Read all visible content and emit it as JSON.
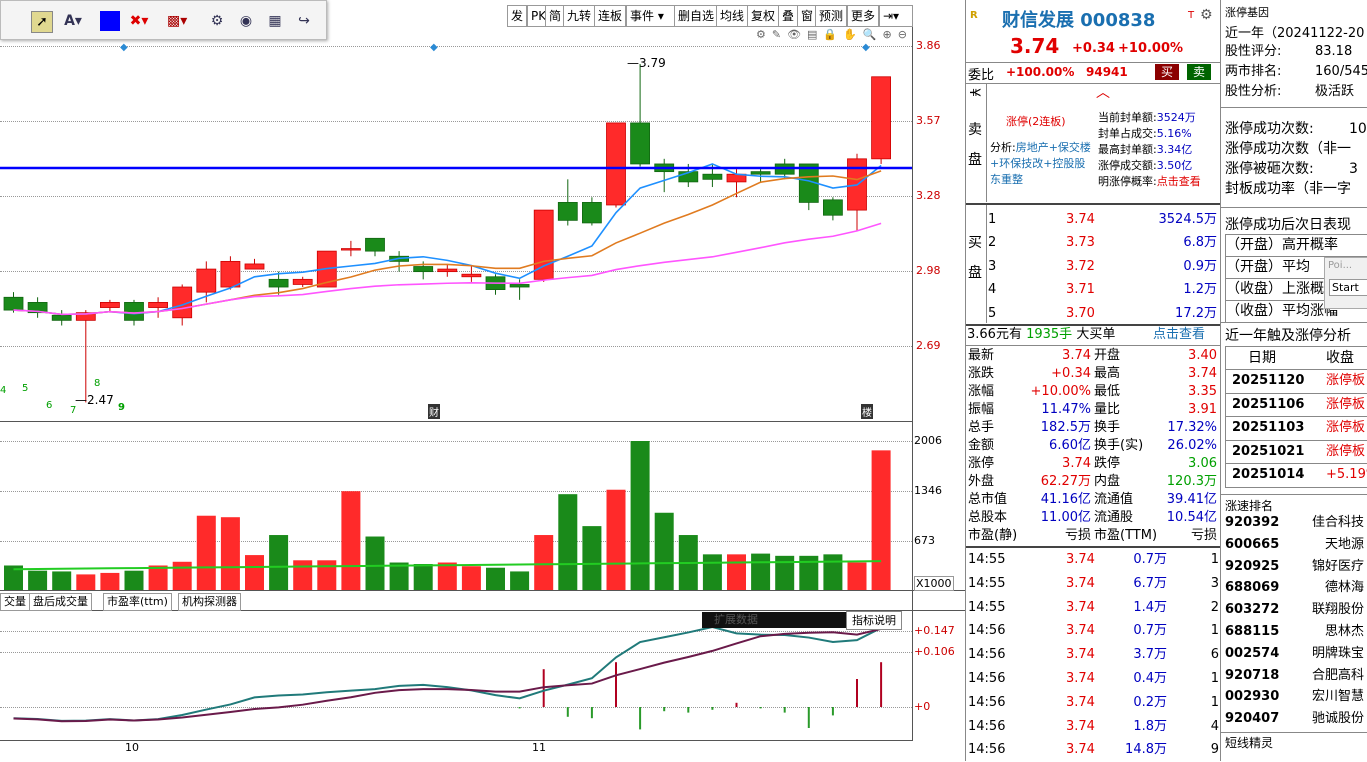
{
  "toolbar": {
    "icons": [
      "cursor-icon",
      "text-tool-icon",
      "color-swatch",
      "delete-icon",
      "draw-style-icon",
      "settings-icon",
      "eye-icon",
      "grid-icon",
      "share-icon"
    ],
    "color_swatch": "#0000ff"
  },
  "top_menu": [
    "发",
    "PK",
    "简",
    "九转",
    "连板",
    "事件",
    "删自选",
    "均线",
    "复权",
    "叠",
    "窗",
    "预测",
    "更多"
  ],
  "price_axis": [
    "3.86",
    "3.57",
    "3.28",
    "2.98",
    "2.69"
  ],
  "volume_axis": [
    "2006",
    "1346",
    "673",
    "X1000"
  ],
  "indicator_axis": [
    "+0.147",
    "+0.106",
    "+0"
  ],
  "chart_labels": {
    "high": "3.79",
    "low": "2.47",
    "cai": "财",
    "lou": "楼"
  },
  "nine_turn": [
    "4",
    "5",
    "6",
    "7",
    "8",
    "9",
    "9"
  ],
  "x_axis": [
    "10",
    "11"
  ],
  "sub_tabs": [
    "交量",
    "盘后成交量",
    "市盈率(ttm)",
    "机构探测器"
  ],
  "indicator_btn": "指标说明",
  "indicator_name": "扩展数据",
  "chart_data": {
    "type": "candlestick",
    "candles": [
      {
        "o": 2.88,
        "c": 2.83,
        "h": 2.9,
        "l": 2.82
      },
      {
        "o": 2.86,
        "c": 2.82,
        "h": 2.88,
        "l": 2.8
      },
      {
        "o": 2.81,
        "c": 2.79,
        "h": 2.83,
        "l": 2.77
      },
      {
        "o": 2.79,
        "c": 2.82,
        "h": 2.83,
        "l": 2.47
      },
      {
        "o": 2.84,
        "c": 2.86,
        "h": 2.87,
        "l": 2.82
      },
      {
        "o": 2.86,
        "c": 2.79,
        "h": 2.87,
        "l": 2.77
      },
      {
        "o": 2.84,
        "c": 2.86,
        "h": 2.88,
        "l": 2.8
      },
      {
        "o": 2.8,
        "c": 2.92,
        "h": 2.93,
        "l": 2.77
      },
      {
        "o": 2.9,
        "c": 2.99,
        "h": 3.02,
        "l": 2.86
      },
      {
        "o": 2.92,
        "c": 3.02,
        "h": 3.04,
        "l": 2.91
      },
      {
        "o": 2.99,
        "c": 3.01,
        "h": 3.03,
        "l": 2.99
      },
      {
        "o": 2.95,
        "c": 2.92,
        "h": 2.98,
        "l": 2.89
      },
      {
        "o": 2.93,
        "c": 2.95,
        "h": 2.96,
        "l": 2.92
      },
      {
        "o": 2.92,
        "c": 3.06,
        "h": 3.06,
        "l": 2.92
      },
      {
        "o": 3.07,
        "c": 3.07,
        "h": 3.1,
        "l": 3.04
      },
      {
        "o": 3.11,
        "c": 3.06,
        "h": 3.11,
        "l": 3.04
      },
      {
        "o": 3.04,
        "c": 3.02,
        "h": 3.06,
        "l": 2.98
      },
      {
        "o": 3.0,
        "c": 2.98,
        "h": 3.02,
        "l": 2.95
      },
      {
        "o": 2.98,
        "c": 2.99,
        "h": 3.01,
        "l": 2.96
      },
      {
        "o": 2.96,
        "c": 2.97,
        "h": 3.0,
        "l": 2.94
      },
      {
        "o": 2.96,
        "c": 2.91,
        "h": 2.97,
        "l": 2.89
      },
      {
        "o": 2.93,
        "c": 2.92,
        "h": 2.95,
        "l": 2.87
      },
      {
        "o": 2.95,
        "c": 3.22,
        "h": 3.22,
        "l": 2.94
      },
      {
        "o": 3.25,
        "c": 3.18,
        "h": 3.34,
        "l": 3.16
      },
      {
        "o": 3.25,
        "c": 3.17,
        "h": 3.27,
        "l": 3.16
      },
      {
        "o": 3.24,
        "c": 3.56,
        "h": 3.56,
        "l": 3.23
      },
      {
        "o": 3.56,
        "c": 3.4,
        "h": 3.79,
        "l": 3.39
      },
      {
        "o": 3.4,
        "c": 3.37,
        "h": 3.42,
        "l": 3.29
      },
      {
        "o": 3.37,
        "c": 3.33,
        "h": 3.4,
        "l": 3.31
      },
      {
        "o": 3.36,
        "c": 3.34,
        "h": 3.4,
        "l": 3.31
      },
      {
        "o": 3.33,
        "c": 3.36,
        "h": 3.38,
        "l": 3.27
      },
      {
        "o": 3.37,
        "c": 3.36,
        "h": 3.38,
        "l": 3.33
      },
      {
        "o": 3.4,
        "c": 3.36,
        "h": 3.42,
        "l": 3.34
      },
      {
        "o": 3.4,
        "c": 3.25,
        "h": 3.4,
        "l": 3.22
      },
      {
        "o": 3.26,
        "c": 3.2,
        "h": 3.27,
        "l": 3.18
      },
      {
        "o": 3.22,
        "c": 3.42,
        "h": 3.44,
        "l": 3.14
      },
      {
        "o": 3.42,
        "c": 3.74,
        "h": 3.74,
        "l": 3.4
      }
    ],
    "volumes": [
      330,
      260,
      250,
      210,
      230,
      260,
      330,
      380,
      1000,
      980,
      470,
      740,
      400,
      400,
      1330,
      720,
      370,
      350,
      370,
      320,
      300,
      250,
      740,
      1290,
      860,
      1350,
      2006,
      1040,
      740,
      480,
      480,
      490,
      460,
      460,
      480,
      370,
      1880
    ],
    "xlabels": [
      "10",
      "11"
    ]
  },
  "stock": {
    "name": "财信发展 000838",
    "price": "3.74",
    "change": "+0.34",
    "pct": "+10.00%",
    "weibi_label": "委比",
    "weibi_val": "+100.00%",
    "weibi_num": "94941",
    "buy_btn": "买",
    "sell_btn": "卖",
    "sell_side": "卖盘",
    "buy_side": "买盘",
    "limit_up_tag": "涨停(2连板)",
    "analysis_prefix": "分析:",
    "analysis_text": "房地产+保交楼+环保技改+控股股东重整",
    "seal_rows": [
      {
        "k": "当前封单额:",
        "v": "3524万"
      },
      {
        "k": "封单占成交:",
        "v": "5.16%"
      },
      {
        "k": "最高封单额:",
        "v": "3.34亿"
      },
      {
        "k": "涨停成交额:",
        "v": "3.50亿"
      },
      {
        "k": "明涨停概率:",
        "v": "点击查看"
      }
    ],
    "bids": [
      {
        "lvl": "1",
        "p": "3.74",
        "q": "3524.5万"
      },
      {
        "lvl": "2",
        "p": "3.73",
        "q": "6.8万"
      },
      {
        "lvl": "3",
        "p": "3.72",
        "q": "0.9万"
      },
      {
        "lvl": "4",
        "p": "3.71",
        "q": "1.2万"
      },
      {
        "lvl": "5",
        "p": "3.70",
        "q": "17.2万"
      }
    ],
    "big_order": {
      "price": "3.66元有",
      "qty": "1935手",
      "label": "大买单",
      "link": "点击查看"
    },
    "stats": [
      [
        "最新",
        "3.74",
        "开盘",
        "3.40"
      ],
      [
        "涨跌",
        "+0.34",
        "最高",
        "3.74"
      ],
      [
        "涨幅",
        "+10.00%",
        "最低",
        "3.35"
      ],
      [
        "振幅",
        "11.47%",
        "量比",
        "3.91"
      ],
      [
        "总手",
        "182.5万",
        "换手",
        "17.32%"
      ],
      [
        "金额",
        "6.60亿",
        "换手(实)",
        "26.02%"
      ],
      [
        "涨停",
        "3.74",
        "跌停",
        "3.06"
      ],
      [
        "外盘",
        "62.27万",
        "内盘",
        "120.3万"
      ],
      [
        "总市值",
        "41.16亿",
        "流通值",
        "39.41亿"
      ],
      [
        "总股本",
        "11.00亿",
        "流通股",
        "10.54亿"
      ],
      [
        "市盈(静)",
        "亏损",
        "市盈(TTM)",
        "亏损"
      ]
    ],
    "ticks": [
      [
        "14:55",
        "3.74",
        "0.7万",
        "1"
      ],
      [
        "14:55",
        "3.74",
        "6.7万",
        "3"
      ],
      [
        "14:55",
        "3.74",
        "1.4万",
        "2"
      ],
      [
        "14:56",
        "3.74",
        "0.7万",
        "1"
      ],
      [
        "14:56",
        "3.74",
        "3.7万",
        "6"
      ],
      [
        "14:56",
        "3.74",
        "0.4万",
        "1"
      ],
      [
        "14:56",
        "3.74",
        "0.2万",
        "1"
      ],
      [
        "14:56",
        "3.74",
        "1.8万",
        "4"
      ],
      [
        "14:56",
        "3.74",
        "14.8万",
        "9"
      ]
    ]
  },
  "side": {
    "title": "涨停基因",
    "period": "近一年（20241122-20",
    "info": [
      {
        "k": "股性评分:",
        "v": "83.18"
      },
      {
        "k": "两市排名:",
        "v": "160/545"
      },
      {
        "k": "股性分析:",
        "v": "极活跃"
      }
    ],
    "counts": [
      {
        "k": "涨停成功次数:",
        "v": "10"
      },
      {
        "k": "涨停成功次数（非一",
        "v": ""
      },
      {
        "k": "涨停被砸次数:",
        "v": "3"
      },
      {
        "k": "封板成功率（非一字",
        "v": ""
      }
    ],
    "next_day_title": "涨停成功后次日表现",
    "next_day": [
      "（开盘）高开概率",
      "（开盘）平均",
      "（收盘）上涨概",
      "（收盘）平均涨幅"
    ],
    "popup": [
      "Poi...",
      "Start"
    ],
    "near_title": "近一年触及涨停分析",
    "near_head": [
      "日期",
      "收盘"
    ],
    "near_rows": [
      [
        "20251120",
        "涨停板"
      ],
      [
        "20251106",
        "涨停板"
      ],
      [
        "20251103",
        "涨停板"
      ],
      [
        "20251021",
        "涨停板"
      ],
      [
        "20251014",
        "+5.19%"
      ]
    ],
    "rank_title": "涨速排名",
    "rank_rows": [
      [
        "920392",
        "佳合科技"
      ],
      [
        "600665",
        "天地源"
      ],
      [
        "920925",
        "锦好医疗"
      ],
      [
        "688069",
        "德林海"
      ],
      [
        "603272",
        "联翔股份"
      ],
      [
        "688115",
        "思林杰"
      ],
      [
        "002574",
        "明牌珠宝"
      ],
      [
        "920718",
        "合肥高科"
      ],
      [
        "002930",
        "宏川智慧"
      ],
      [
        "920407",
        "驰诚股份"
      ]
    ],
    "short_title": "短线精灵"
  }
}
